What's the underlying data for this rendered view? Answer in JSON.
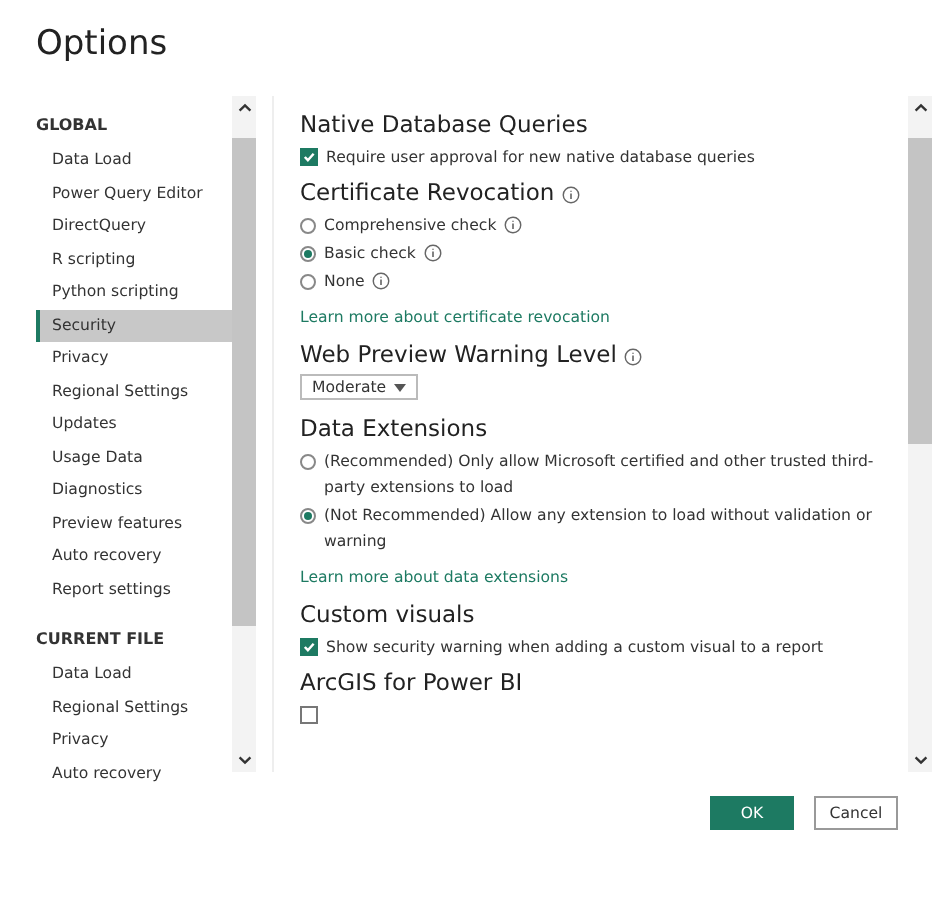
{
  "window": {
    "title": "Options"
  },
  "sidebar": {
    "groups": [
      {
        "heading": "GLOBAL",
        "items": [
          {
            "label": "Data Load",
            "selected": false
          },
          {
            "label": "Power Query Editor",
            "selected": false
          },
          {
            "label": "DirectQuery",
            "selected": false
          },
          {
            "label": "R scripting",
            "selected": false
          },
          {
            "label": "Python scripting",
            "selected": false
          },
          {
            "label": "Security",
            "selected": true
          },
          {
            "label": "Privacy",
            "selected": false
          },
          {
            "label": "Regional Settings",
            "selected": false
          },
          {
            "label": "Updates",
            "selected": false
          },
          {
            "label": "Usage Data",
            "selected": false
          },
          {
            "label": "Diagnostics",
            "selected": false
          },
          {
            "label": "Preview features",
            "selected": false
          },
          {
            "label": "Auto recovery",
            "selected": false
          },
          {
            "label": "Report settings",
            "selected": false
          }
        ]
      },
      {
        "heading": "CURRENT FILE",
        "items": [
          {
            "label": "Data Load",
            "selected": false
          },
          {
            "label": "Regional Settings",
            "selected": false
          },
          {
            "label": "Privacy",
            "selected": false
          },
          {
            "label": "Auto recovery",
            "selected": false
          }
        ]
      }
    ]
  },
  "sections": [
    {
      "title": "Native Database Queries",
      "info": false,
      "items": [
        {
          "kind": "checkbox",
          "label": "Require user approval for new native database queries",
          "checked": true
        }
      ]
    },
    {
      "title": "Certificate Revocation",
      "info": true,
      "items": [
        {
          "kind": "radio",
          "label": "Comprehensive check",
          "info": true,
          "selected": false
        },
        {
          "kind": "radio",
          "label": "Basic check",
          "info": true,
          "selected": true
        },
        {
          "kind": "radio",
          "label": "None",
          "info": true,
          "selected": false
        },
        {
          "kind": "link",
          "label": "Learn more about certificate revocation"
        }
      ]
    },
    {
      "title": "Web Preview Warning Level",
      "info": true,
      "items": [
        {
          "kind": "dropdown",
          "label": "Moderate"
        }
      ]
    },
    {
      "title": "Data Extensions",
      "info": false,
      "items": [
        {
          "kind": "radio",
          "label": "(Recommended) Only allow Microsoft certified and other trusted third-party extensions to load",
          "info": false,
          "selected": false
        },
        {
          "kind": "radio",
          "label": "(Not Recommended) Allow any extension to load without validation or warning",
          "info": false,
          "selected": true
        },
        {
          "kind": "link",
          "label": "Learn more about data extensions"
        }
      ]
    },
    {
      "title": "Custom visuals",
      "info": false,
      "items": [
        {
          "kind": "checkbox",
          "label": "Show security warning when adding a custom visual to a report",
          "checked": true
        }
      ]
    },
    {
      "title": "ArcGIS for Power BI",
      "info": false,
      "items": [
        {
          "kind": "checkbox",
          "checked": false
        }
      ]
    }
  ],
  "buttons": [
    {
      "label": "OK",
      "kind": "primary"
    },
    {
      "label": "Cancel",
      "kind": "secondary"
    }
  ]
}
